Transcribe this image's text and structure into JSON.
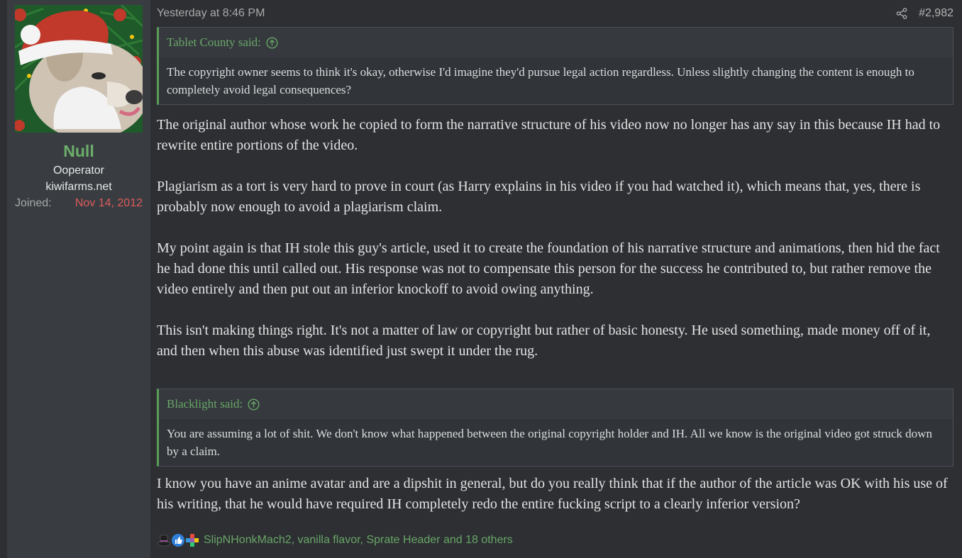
{
  "user": {
    "name": "Null",
    "title": "Ooperator",
    "site": "kiwifarms.net",
    "joined_label": "Joined:",
    "joined_date": "Nov 14, 2012"
  },
  "post": {
    "timestamp": "Yesterday at 8:46 PM",
    "number": "#2,982",
    "quote1": {
      "author": "Tablet County said:",
      "text": "The copyright owner seems to think it's okay, otherwise I'd imagine they'd pursue legal action regardless. Unless slightly changing the content is enough to completely avoid legal consequences?"
    },
    "paragraphs": [
      "The original author whose work he copied to form the narrative structure of his video now no longer has any say in this because IH had to rewrite entire portions of the video.",
      "Plagiarism as a tort is very hard to prove in court (as Harry explains in his video if you had watched it), which means that, yes, there is probably now enough to avoid a plagiarism claim.",
      "My point again is that IH stole this guy's article, used it to create the foundation of his narrative structure and animations, then hid the fact he had done this until called out. His response was not to compensate this person for the success he contributed to, but rather remove the video entirely and then put out an inferior knockoff to avoid owing anything.",
      "This isn't making things right. It's not a matter of law or copyright but rather of basic honesty. He used something, made money off of it, and then when this abuse was identified just swept it under the rug."
    ],
    "quote2": {
      "author": "Blacklight said:",
      "text": "You are assuming a lot of shit. We don't know what happened between the original copyright holder and IH. All we know is the original video got struck down by a claim."
    },
    "reply": "I know you have an anime avatar and are a dipshit in general, but do you really think that if the author of the article was OK with his use of his writing, that he would have required IH completely redo the entire fucking script to a clearly inferior version?",
    "reactions": "SlipNHonkMach2, vanilla flavor, Sprate Header and 18 others"
  },
  "colors": {
    "username": "#6cae6a",
    "joined_date": "#e05b5b",
    "quote_accent": "#5a9e5a",
    "link": "#68a566"
  },
  "icons": [
    "share-icon",
    "goto-quote-icon",
    "tophat-reaction-icon",
    "thumbs-up-reaction-icon",
    "autistic-reaction-icon"
  ]
}
